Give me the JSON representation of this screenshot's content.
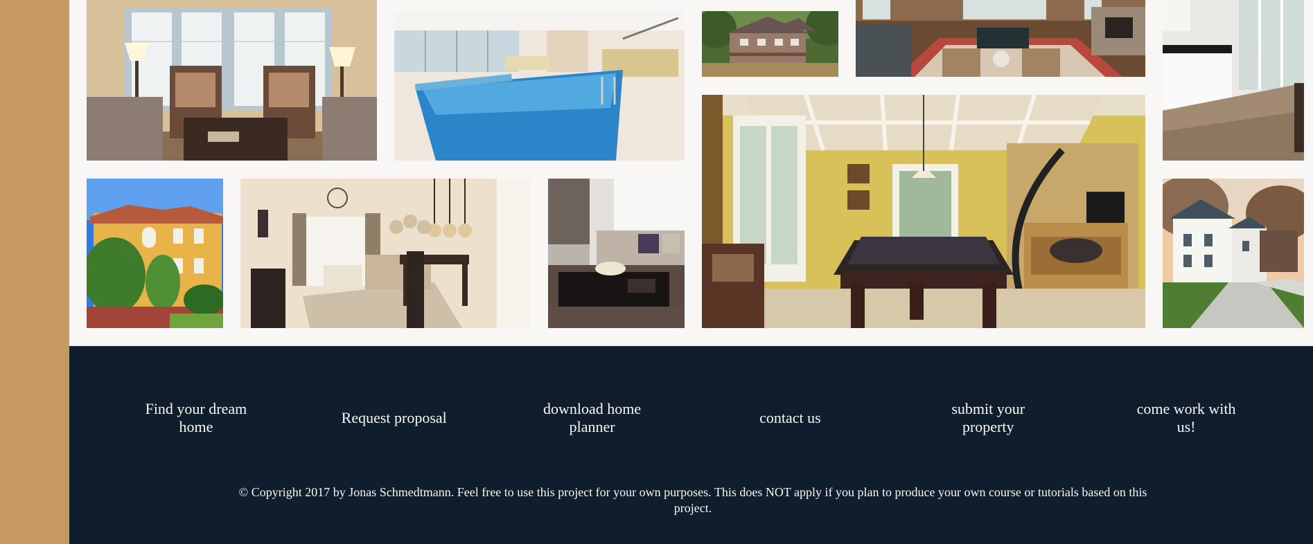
{
  "colors": {
    "sidebar": "#c69963",
    "gallery_bg": "#f9f7f6",
    "footer_bg": "#101d2c",
    "footer_text": "#f9f7f6"
  },
  "gallery": {
    "images": [
      {
        "name": "living-room-armchairs"
      },
      {
        "name": "indoor-pool"
      },
      {
        "name": "house-exterior-woods"
      },
      {
        "name": "luxury-living-room"
      },
      {
        "name": "modern-kitchen"
      },
      {
        "name": "mediterranean-villa"
      },
      {
        "name": "dining-living-room"
      },
      {
        "name": "lounge-sofa"
      },
      {
        "name": "billiard-room"
      },
      {
        "name": "white-house-driveway"
      }
    ]
  },
  "footer": {
    "nav": [
      {
        "label": "Find your dream home"
      },
      {
        "label": "Request proposal"
      },
      {
        "label": "download home planner"
      },
      {
        "label": "contact us"
      },
      {
        "label": "submit your property"
      },
      {
        "label": "come work with us!"
      }
    ],
    "copyright": "© Copyright 2017 by Jonas Schmedtmann. Feel free to use this project for your own purposes. This does NOT apply if you plan to produce your own course or tutorials based on this project."
  }
}
